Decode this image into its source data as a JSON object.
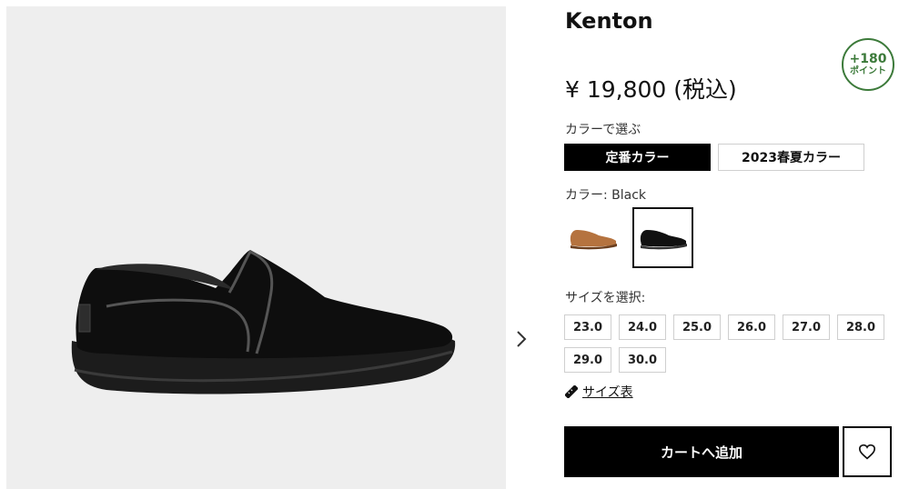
{
  "product": {
    "name": "Kenton",
    "price": "¥ 19,800 (税込)",
    "points": {
      "value": "+180",
      "unit": "ポイント"
    }
  },
  "color_selector": {
    "label": "カラーで選ぶ",
    "tabs": [
      {
        "label": "定番カラー",
        "active": true
      },
      {
        "label": "2023春夏カラー",
        "active": false
      }
    ],
    "current_label": "カラー: Black",
    "swatches": [
      {
        "name": "chestnut",
        "color": "#b5733f",
        "selected": false
      },
      {
        "name": "black",
        "color": "#111111",
        "selected": true
      }
    ]
  },
  "size_selector": {
    "label": "サイズを選択:",
    "sizes": [
      "23.0",
      "24.0",
      "25.0",
      "26.0",
      "27.0",
      "28.0",
      "29.0",
      "30.0"
    ],
    "guide_label": "サイズ表"
  },
  "actions": {
    "cart_label": "カートへ追加",
    "favorite_icon": "heart-icon"
  },
  "gallery": {
    "background": "#eeeeee",
    "next_icon": "chevron-right-icon"
  },
  "colors": {
    "points_green": "#3c7a3a",
    "primary": "#000000"
  }
}
